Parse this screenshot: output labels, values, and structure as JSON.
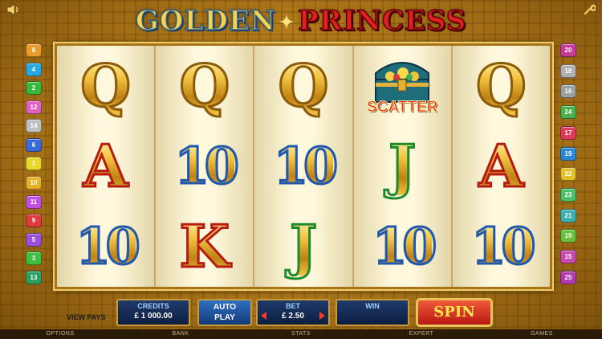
{
  "game": {
    "title_part1": "GOLDEN",
    "title_part2": "PRINCESS"
  },
  "icons": {
    "sound": "speaker-icon",
    "settings": "wrench-icon"
  },
  "reels": [
    [
      {
        "symbol": "Q",
        "color": "gold"
      },
      {
        "symbol": "A",
        "color": "red"
      },
      {
        "symbol": "10",
        "color": "blue"
      }
    ],
    [
      {
        "symbol": "Q",
        "color": "gold"
      },
      {
        "symbol": "10",
        "color": "blue"
      },
      {
        "symbol": "K",
        "color": "red"
      }
    ],
    [
      {
        "symbol": "Q",
        "color": "gold"
      },
      {
        "symbol": "10",
        "color": "blue"
      },
      {
        "symbol": "J",
        "color": "green"
      }
    ],
    [
      {
        "symbol": "scatter",
        "color": "scatter",
        "label": "SCATTER"
      },
      {
        "symbol": "J",
        "color": "green"
      },
      {
        "symbol": "10",
        "color": "blue"
      }
    ],
    [
      {
        "symbol": "Q",
        "color": "gold"
      },
      {
        "symbol": "A",
        "color": "red"
      },
      {
        "symbol": "10",
        "color": "blue"
      }
    ]
  ],
  "paylines_left": [
    {
      "n": "8",
      "color": "#e89a2a"
    },
    {
      "n": "4",
      "color": "#2aa8e0"
    },
    {
      "n": "2",
      "color": "#3ab83a"
    },
    {
      "n": "12",
      "color": "#e060c0"
    },
    {
      "n": "14",
      "color": "#c0c0c0"
    },
    {
      "n": "6",
      "color": "#3a6ad8"
    },
    {
      "n": "1",
      "color": "#e8d82a"
    },
    {
      "n": "10",
      "color": "#e8b02a"
    },
    {
      "n": "11",
      "color": "#c050e0"
    },
    {
      "n": "9",
      "color": "#e03a3a"
    },
    {
      "n": "5",
      "color": "#9a50d8"
    },
    {
      "n": "3",
      "color": "#40c040"
    },
    {
      "n": "13",
      "color": "#2aa060"
    }
  ],
  "paylines_right": [
    {
      "n": "20",
      "color": "#c83a9a"
    },
    {
      "n": "18",
      "color": "#b0b0b0"
    },
    {
      "n": "16",
      "color": "#9aa0a0"
    },
    {
      "n": "24",
      "color": "#4ab04a"
    },
    {
      "n": "17",
      "color": "#e03a5a"
    },
    {
      "n": "19",
      "color": "#2a8ad8"
    },
    {
      "n": "22",
      "color": "#e0c02a"
    },
    {
      "n": "23",
      "color": "#4ac06a"
    },
    {
      "n": "21",
      "color": "#3ab0b0"
    },
    {
      "n": "19",
      "color": "#6ac040"
    },
    {
      "n": "15",
      "color": "#c84ab0"
    },
    {
      "n": "25",
      "color": "#b03ab0"
    }
  ],
  "controls": {
    "view_pays": "VIEW PAYS",
    "credits_label": "CREDITS",
    "credits_value": "£ 1 000.00",
    "autoplay_line1": "AUTO",
    "autoplay_line2": "PLAY",
    "bet_label": "BET",
    "bet_value": "£ 2.50",
    "win_label": "WIN",
    "win_value": "",
    "spin_label": "SPIN"
  },
  "menu": [
    "OPTIONS",
    "BANK",
    "STATS",
    "EXPERT",
    "GAMES"
  ]
}
